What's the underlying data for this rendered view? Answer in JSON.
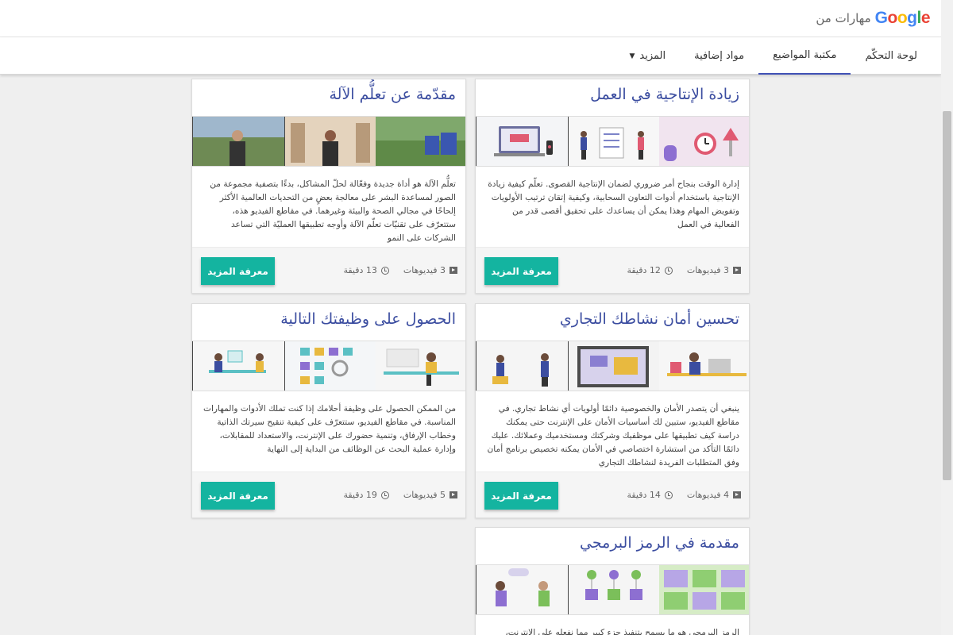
{
  "header": {
    "brand_label": "مهارات من",
    "logo_text": "Google"
  },
  "nav": {
    "tabs": [
      {
        "label": "لوحة التحكّم"
      },
      {
        "label": "مكتبة المواضيع"
      },
      {
        "label": "مواد إضافية"
      },
      {
        "label": "المزيد"
      }
    ]
  },
  "colors": {
    "accent": "#3f51b5",
    "button": "#14b4a0",
    "title": "#3b4da0"
  },
  "cards": [
    {
      "title": "زيادة الإنتاجية في العمل",
      "description": "إدارة الوقت بنجاح أمر ضروري لضمان الإنتاجية القصوى. تعلّم كيفية زيادة الإنتاجية باستخدام أدوات التعاون السحابية، وكيفية إتقان ترتيب الأولويات وتفويض المهام وهذا يمكن أن يساعدك على تحقيق أقصى قدر من الفعالية في العمل",
      "videos": "3 فيديوهات",
      "duration": "12 دقيقة",
      "button": "معرفة المزيد"
    },
    {
      "title": "مقدّمة عن تعلُّم الآلة",
      "description": "تعلُّم الآلة هو أداة جديدة وفعّالة لحلّ المشاكل، بدءًا بتصفية مجموعة من الصور لمساعدة البشر على معالجة بعضٍ من التحديات العالمية الأكثر إلحاحًا في مجالي الصحة والبيئة وغيرهما. في مقاطع الفيديو هذه، ستتعرّف على تقنيّات تعلّم الآلة وأوجه تطبيقها العمليّة التي تساعد الشركات على النمو",
      "videos": "3 فيديوهات",
      "duration": "13 دقيقة",
      "button": "معرفة المزيد"
    },
    {
      "title": "تحسين أمان نشاطك التجاري",
      "description": "ينبغي أن يتصدر الأمان والخصوصية دائمًا أولويات أي نشاط تجاري. في مقاطع الفيديو، ستبين لك أساسيات الأمان على الإنترنت حتى يمكنك دراسة كيف تطبيقها على موظفيك وشركتك ومستخدميك وعملائك. عليك دائمًا التأكد من استشارة اختصاصي في الأمان يمكنه تخصيص برنامج أمان وفق المتطلبات الفريدة لنشاطك التجاري",
      "videos": "4 فيديوهات",
      "duration": "14 دقيقة",
      "button": "معرفة المزيد"
    },
    {
      "title": "الحصول على وظيفتك التالية",
      "description": "من الممكن الحصول على وظيفة أحلامك إذا كنت تملك الأدوات والمهارات المناسبة. في مقاطع الفيديو، ستتعرّف على كيفية تنقيح سيرتك الذاتية وخطاب الإرفاق، وتنمية حضورك على الإنترنت، والاستعداد للمقابلات، وإدارة عملية البحث عن الوظائف من البداية إلى النهاية",
      "videos": "5 فيديوهات",
      "duration": "19 دقيقة",
      "button": "معرفة المزيد"
    },
    {
      "title": "مقدمة في الرمز البرمجي",
      "description": "الرمز البرمجي هو ما يسمح بتنفيذ جزء كبير مما نفعله على الإنترنت، سواء"
    }
  ]
}
